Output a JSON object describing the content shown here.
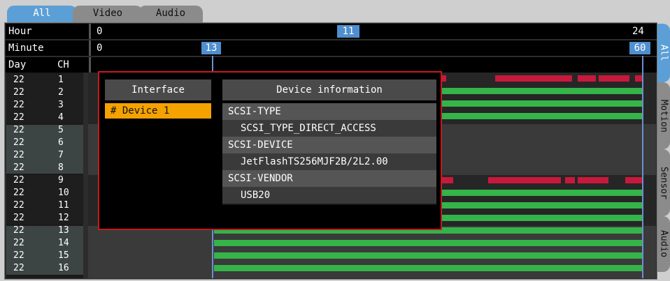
{
  "tabs": [
    {
      "label": "All",
      "active": true
    },
    {
      "label": "Video",
      "active": false
    },
    {
      "label": "Audio",
      "active": false
    }
  ],
  "hour_row": {
    "label": "Hour",
    "start": "0",
    "current": "11",
    "end": "24"
  },
  "minute_row": {
    "label": "Minute",
    "start": "0",
    "current": "13",
    "end": "60"
  },
  "columns": {
    "day": "Day",
    "ch": "CH"
  },
  "channels": [
    {
      "day": "22",
      "ch": "1"
    },
    {
      "day": "22",
      "ch": "2"
    },
    {
      "day": "22",
      "ch": "3"
    },
    {
      "day": "22",
      "ch": "4"
    },
    {
      "day": "22",
      "ch": "5"
    },
    {
      "day": "22",
      "ch": "6"
    },
    {
      "day": "22",
      "ch": "7"
    },
    {
      "day": "22",
      "ch": "8"
    },
    {
      "day": "22",
      "ch": "9"
    },
    {
      "day": "22",
      "ch": "10"
    },
    {
      "day": "22",
      "ch": "11"
    },
    {
      "day": "22",
      "ch": "12"
    },
    {
      "day": "22",
      "ch": "13"
    },
    {
      "day": "22",
      "ch": "14"
    },
    {
      "day": "22",
      "ch": "15"
    },
    {
      "day": "22",
      "ch": "16"
    }
  ],
  "dialog": {
    "interface_header": "Interface",
    "device_info_header": "Device information",
    "devices": [
      "# Device 1"
    ],
    "info": [
      {
        "key": "SCSI-TYPE",
        "value": "SCSI_TYPE_DIRECT_ACCESS"
      },
      {
        "key": "SCSI-DEVICE",
        "value": "JetFlashTS256MJF2B/2L2.00"
      },
      {
        "key": "SCSI-VENDOR",
        "value": "USB20"
      }
    ]
  },
  "side_tabs": [
    {
      "label": "All",
      "active": true
    },
    {
      "label": "Motion",
      "active": false
    },
    {
      "label": "Sensor",
      "active": false
    },
    {
      "label": "Audio",
      "active": false
    }
  ],
  "colors": {
    "accent": "#5c9fd6",
    "recording": "#35b44a",
    "event": "#c8193c",
    "selection": "#f5a200",
    "dialog_border": "#c8181f"
  }
}
